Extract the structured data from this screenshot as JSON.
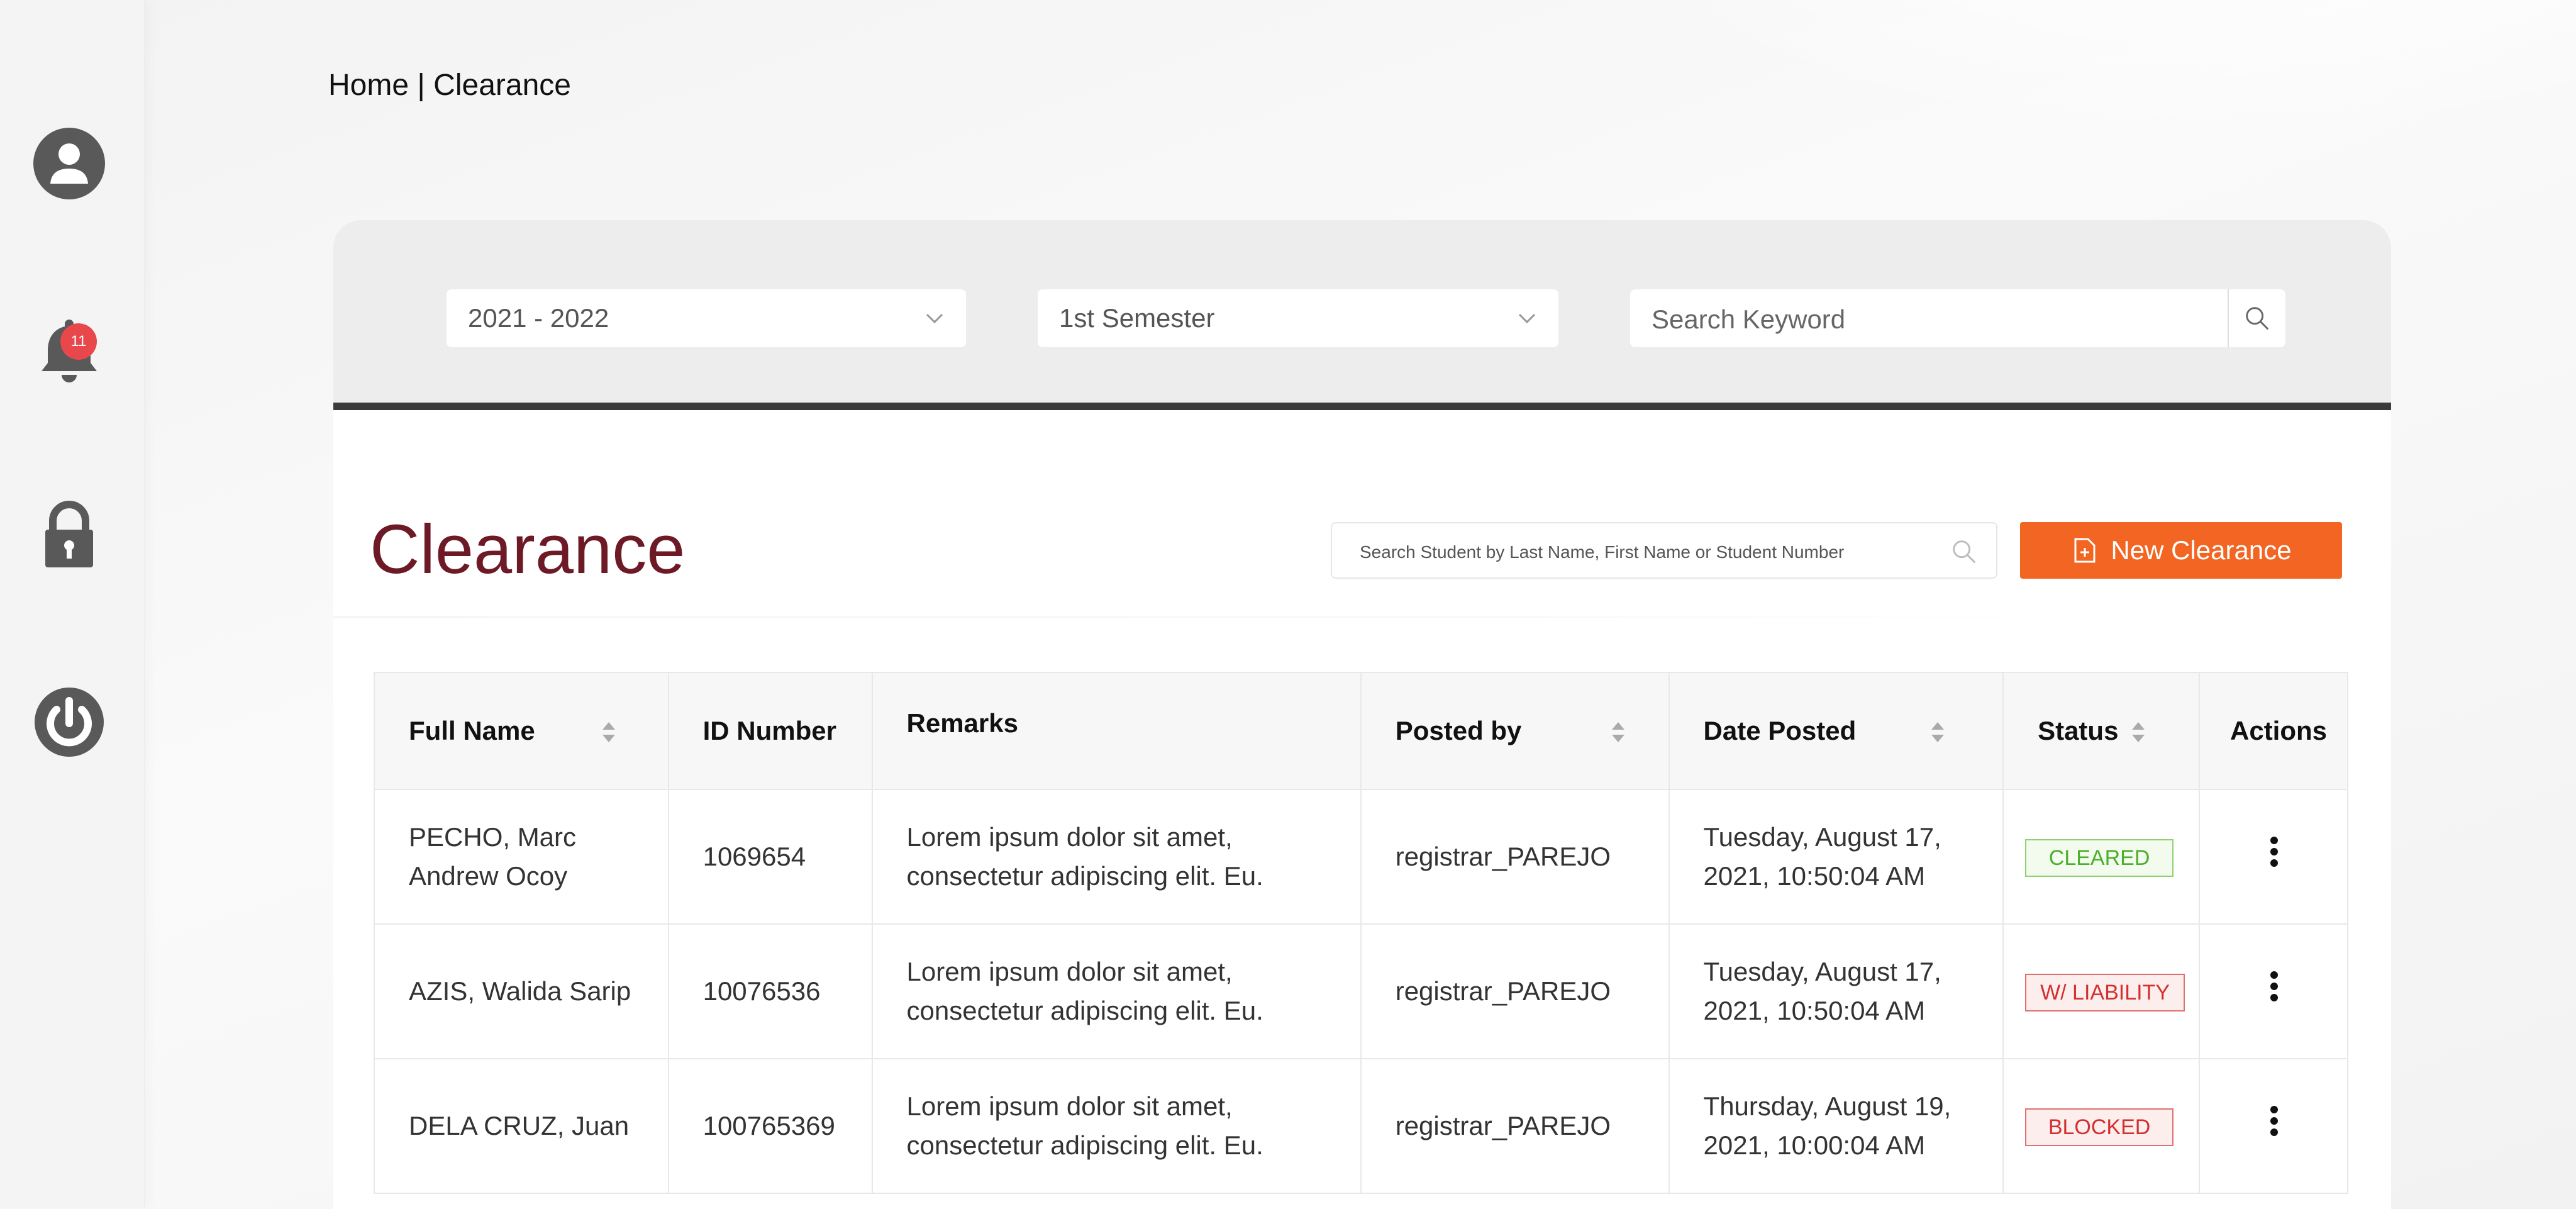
{
  "breadcrumb": "Home | Clearance",
  "sidebar": {
    "items": [
      {
        "icon": "user-icon"
      },
      {
        "icon": "bell-icon",
        "badge": "11"
      },
      {
        "icon": "lock-icon"
      },
      {
        "icon": "power-icon"
      }
    ]
  },
  "filters": {
    "school_year": "2021 - 2022",
    "semester": "1st Semester",
    "keyword_placeholder": "Search Keyword"
  },
  "clearance": {
    "title": "Clearance",
    "student_search_placeholder": "Search Student by Last Name, First Name or Student Number",
    "new_button": "New Clearance"
  },
  "table": {
    "headers": {
      "full_name": "Full Name",
      "id_number": "ID Number",
      "remarks": "Remarks",
      "posted_by": "Posted by",
      "date_posted": "Date Posted",
      "status": "Status",
      "actions": "Actions"
    },
    "rows": [
      {
        "name_line1": "PECHO, Marc",
        "name_line2": "Andrew Ocoy",
        "id": "1069654",
        "remarks_line1": "Lorem ipsum dolor sit amet,",
        "remarks_line2": "consectetur adipiscing elit. Eu.",
        "posted_by": "registrar_PAREJO",
        "date_line1": "Tuesday, August 17,",
        "date_line2": "2021, 10:50:04 AM",
        "status": "CLEARED"
      },
      {
        "name_line1": "AZIS, Walida Sarip",
        "name_line2": "",
        "id": "10076536",
        "remarks_line1": "Lorem ipsum dolor sit amet,",
        "remarks_line2": "consectetur adipiscing elit. Eu.",
        "posted_by": "registrar_PAREJO",
        "date_line1": "Tuesday, August 17,",
        "date_line2": "2021, 10:50:04 AM",
        "status": "W/ LIABILITY"
      },
      {
        "name_line1": "DELA CRUZ, Juan",
        "name_line2": "",
        "id": "100765369",
        "remarks_line1": "Lorem ipsum dolor sit amet,",
        "remarks_line2": "consectetur adipiscing elit. Eu.",
        "posted_by": "registrar_PAREJO",
        "date_line1": "Thursday, August 19,",
        "date_line2": "2021, 10:00:04 AM",
        "status": "BLOCKED"
      }
    ]
  },
  "colors": {
    "accent": "#f26522",
    "title": "#6d1a26",
    "icon": "#595959",
    "cleared": "#4caf2a",
    "liability": "#d32f2f",
    "badge": "#e8474b"
  }
}
